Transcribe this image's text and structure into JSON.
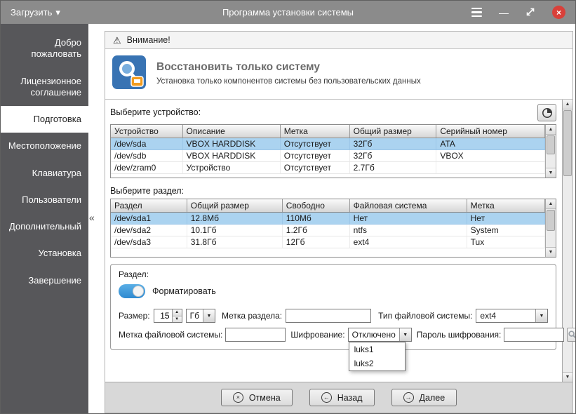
{
  "titlebar": {
    "load_button": "Загрузить",
    "title": "Программа установки системы"
  },
  "sidebar": {
    "items": [
      {
        "label": "Добро пожаловать",
        "active": false
      },
      {
        "label": "Лицензионное соглашение",
        "active": false
      },
      {
        "label": "Подготовка",
        "active": true
      },
      {
        "label": "Местоположение",
        "active": false
      },
      {
        "label": "Клавиатура",
        "active": false
      },
      {
        "label": "Пользователи",
        "active": false
      },
      {
        "label": "Дополнительный",
        "active": false
      },
      {
        "label": "Установка",
        "active": false
      },
      {
        "label": "Завершение",
        "active": false
      }
    ]
  },
  "warning": {
    "label": "Внимание!"
  },
  "header": {
    "title": "Восстановить только систему",
    "subtitle": "Установка только компонентов системы без пользовательских данных"
  },
  "device_section": {
    "label": "Выберите устройство:",
    "table": {
      "headers": [
        "Устройство",
        "Описание",
        "Метка",
        "Общий размер",
        "Серийный номер"
      ],
      "rows": [
        {
          "cells": [
            "/dev/sda",
            "VBOX HARDDISK",
            "Отсутствует",
            "32Гб",
            "ATA"
          ],
          "selected": true
        },
        {
          "cells": [
            "/dev/sdb",
            "VBOX HARDDISK",
            "Отсутствует",
            "32Гб",
            "VBOX"
          ],
          "selected": false
        },
        {
          "cells": [
            "/dev/zram0",
            "Устройство",
            "Отсутствует",
            "2.7Гб",
            ""
          ],
          "selected": false
        }
      ]
    }
  },
  "partition_section": {
    "label": "Выберите раздел:",
    "table": {
      "headers": [
        "Раздел",
        "Общий размер",
        "Свободно",
        "Файловая система",
        "Метка"
      ],
      "rows": [
        {
          "cells": [
            "/dev/sda1",
            "12.8Мб",
            "110Мб",
            "Нет",
            "Нет"
          ],
          "selected": true
        },
        {
          "cells": [
            "/dev/sda2",
            "10.1Гб",
            "1.2Гб",
            "ntfs",
            "System"
          ],
          "selected": false
        },
        {
          "cells": [
            "/dev/sda3",
            "31.8Гб",
            "12Гб",
            "ext4",
            "Tux"
          ],
          "selected": false
        }
      ]
    }
  },
  "partition_form": {
    "group_label": "Раздел:",
    "format_toggle_label": "Форматировать",
    "format_toggle_on": true,
    "size_label": "Размер:",
    "size_value": "15",
    "size_unit": "Гб",
    "partition_label_label": "Метка раздела:",
    "partition_label_value": "",
    "fs_type_label": "Тип файловой системы:",
    "fs_type_value": "ext4",
    "fs_label_label": "Метка файловой системы:",
    "fs_label_value": "",
    "encryption_label": "Шифрование:",
    "encryption_value": "Отключено",
    "encryption_options": [
      "luks1",
      "luks2"
    ],
    "password_label": "Пароль шифрования:",
    "password_value": ""
  },
  "footer": {
    "cancel": "Отмена",
    "back": "Назад",
    "next": "Далее"
  },
  "icons": {
    "caret_down": "▾",
    "minimize": "—",
    "close": "×",
    "warning": "⚠",
    "up": "▲",
    "down": "▼",
    "cancel": "×",
    "back": "←",
    "next": "→",
    "collapse": "«"
  },
  "colors": {
    "titlebar": "#8b8b8b",
    "sidebar": "#57575a",
    "selection": "#abd3f0",
    "toggle_accent": "#2f8ad0",
    "close_button": "#d9403a"
  }
}
